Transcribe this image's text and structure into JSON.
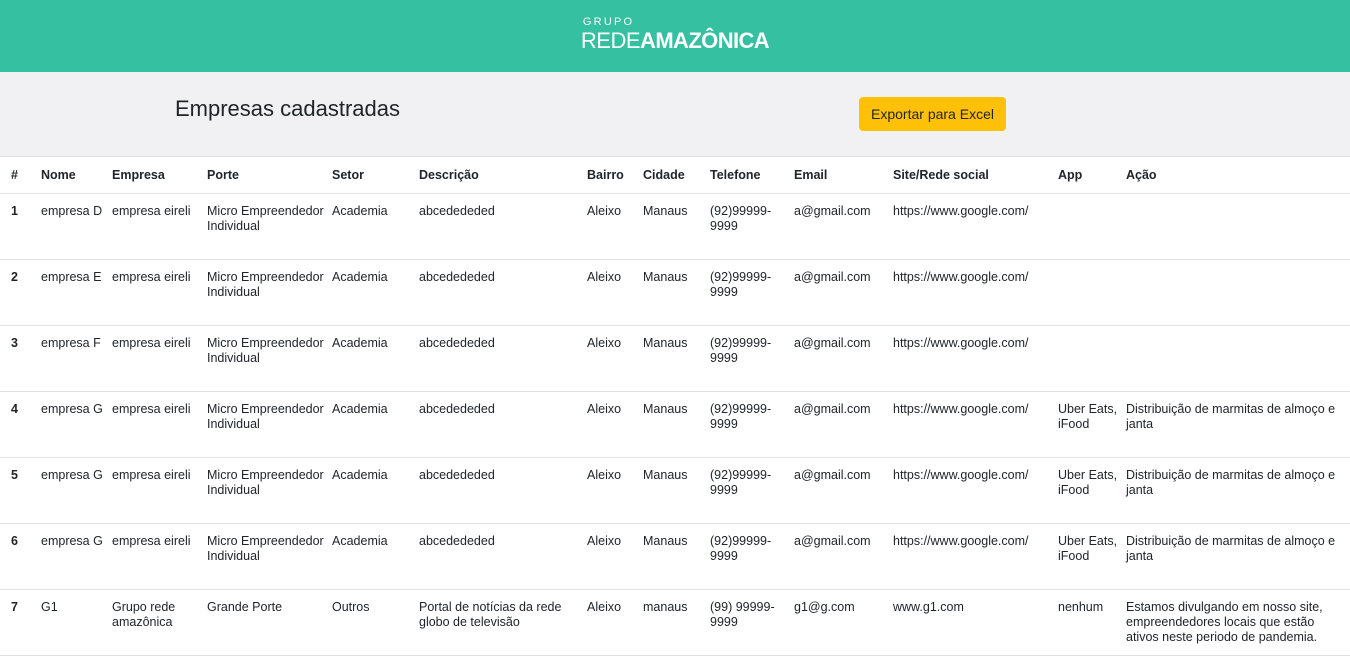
{
  "header": {
    "logo_top": "GRUPO",
    "logo_rede": "REDE",
    "logo_amazonica": "AMAZÔNICA",
    "bg_color": "#35c0a1"
  },
  "page": {
    "title": "Empresas cadastradas",
    "export_label": "Exportar para Excel",
    "export_color": "#ffc107"
  },
  "table": {
    "columns": [
      "#",
      "Nome",
      "Empresa",
      "Porte",
      "Setor",
      "Descrição",
      "Bairro",
      "Cidade",
      "Telefone",
      "Email",
      "Site/Rede social",
      "App",
      "Ação"
    ],
    "rows": [
      [
        "1",
        "empresa D",
        "empresa eireli",
        "Micro Empreendedor Individual",
        "Academia",
        "abcedededed",
        "Aleixo",
        "Manaus",
        "(92)99999-9999",
        "a@gmail.com",
        "https://www.google.com/",
        "",
        ""
      ],
      [
        "2",
        "empresa E",
        "empresa eireli",
        "Micro Empreendedor Individual",
        "Academia",
        "abcedededed",
        "Aleixo",
        "Manaus",
        "(92)99999-9999",
        "a@gmail.com",
        "https://www.google.com/",
        "",
        ""
      ],
      [
        "3",
        "empresa F",
        "empresa eireli",
        "Micro Empreendedor Individual",
        "Academia",
        "abcedededed",
        "Aleixo",
        "Manaus",
        "(92)99999-9999",
        "a@gmail.com",
        "https://www.google.com/",
        "",
        ""
      ],
      [
        "4",
        "empresa G",
        "empresa eireli",
        "Micro Empreendedor Individual",
        "Academia",
        "abcedededed",
        "Aleixo",
        "Manaus",
        "(92)99999-9999",
        "a@gmail.com",
        "https://www.google.com/",
        "Uber Eats, iFood",
        "Distribuição de marmitas de almoço e janta"
      ],
      [
        "5",
        "empresa G",
        "empresa eireli",
        "Micro Empreendedor Individual",
        "Academia",
        "abcedededed",
        "Aleixo",
        "Manaus",
        "(92)99999-9999",
        "a@gmail.com",
        "https://www.google.com/",
        "Uber Eats, iFood",
        "Distribuição de marmitas de almoço e janta"
      ],
      [
        "6",
        "empresa G",
        "empresa eireli",
        "Micro Empreendedor Individual",
        "Academia",
        "abcedededed",
        "Aleixo",
        "Manaus",
        "(92)99999-9999",
        "a@gmail.com",
        "https://www.google.com/",
        "Uber Eats, iFood",
        "Distribuição de marmitas de almoço e janta"
      ],
      [
        "7",
        "G1",
        "Grupo rede amazônica",
        "Grande Porte",
        "Outros",
        "Portal de notícias da rede globo de televisão",
        "Aleixo",
        "manaus",
        "(99) 99999-9999",
        "g1@g.com",
        "www.g1.com",
        "nenhum",
        "Estamos divulgando em nosso site, empreendedores locais que estão ativos neste periodo de pandemia."
      ]
    ]
  }
}
